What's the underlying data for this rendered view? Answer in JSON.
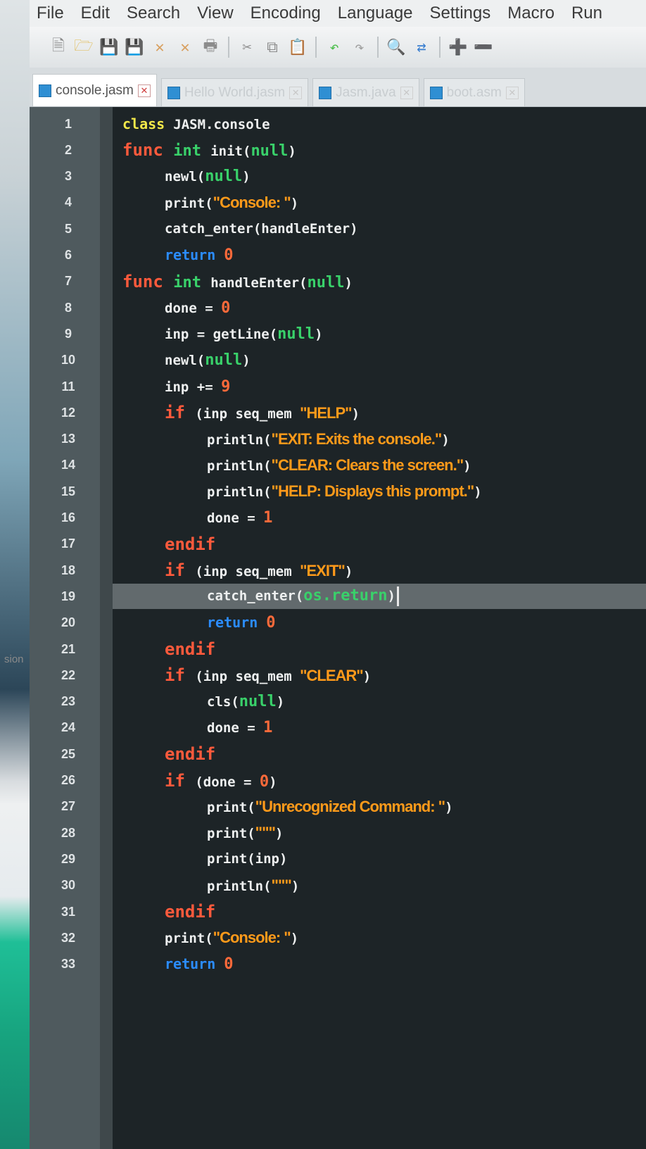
{
  "left_strip": {
    "fragment": "sion"
  },
  "menu": [
    "File",
    "Edit",
    "Search",
    "View",
    "Encoding",
    "Language",
    "Settings",
    "Macro",
    "Run"
  ],
  "toolbar": [
    "new-file-icon",
    "open-file-icon",
    "save-icon",
    "save-all-icon",
    "close-icon",
    "close-all-icon",
    "print-icon",
    "cut-icon",
    "copy-icon",
    "paste-icon",
    "undo-icon",
    "redo-icon",
    "find-icon",
    "replace-icon",
    "zoom-in-icon",
    "zoom-out-icon"
  ],
  "tabs": [
    {
      "label": "console.jasm",
      "active": true
    },
    {
      "label": "Hello World.jasm",
      "active": false
    },
    {
      "label": "Jasm.java",
      "active": false
    },
    {
      "label": "boot.asm",
      "active": false
    }
  ],
  "editor": {
    "current_line": 19,
    "lines": [
      {
        "n": "1",
        "indent": 0,
        "tokens": [
          [
            "cls",
            "class "
          ],
          [
            "t",
            "JASM.console"
          ]
        ]
      },
      {
        "n": "2",
        "indent": 0,
        "tokens": [
          [
            "red",
            "func "
          ],
          [
            "grn",
            "int "
          ],
          [
            "t",
            "init("
          ],
          [
            "grn",
            "null"
          ],
          [
            "t",
            ")"
          ]
        ]
      },
      {
        "n": "3",
        "indent": 2,
        "tokens": [
          [
            "t",
            "newl("
          ],
          [
            "grn",
            "null"
          ],
          [
            "t",
            ")"
          ]
        ]
      },
      {
        "n": "4",
        "indent": 2,
        "tokens": [
          [
            "t",
            "print("
          ],
          [
            "str",
            "\"Console: \""
          ],
          [
            "t",
            ")"
          ]
        ]
      },
      {
        "n": "5",
        "indent": 2,
        "tokens": [
          [
            "t",
            "catch_enter(handleEnter)"
          ]
        ]
      },
      {
        "n": "6",
        "indent": 2,
        "tokens": [
          [
            "blu",
            "return "
          ],
          [
            "num",
            "0"
          ]
        ]
      },
      {
        "n": "7",
        "indent": 0,
        "tokens": [
          [
            "red",
            "func "
          ],
          [
            "grn",
            "int "
          ],
          [
            "t",
            "handleEnter("
          ],
          [
            "grn",
            "null"
          ],
          [
            "t",
            ")"
          ]
        ]
      },
      {
        "n": "8",
        "indent": 2,
        "tokens": [
          [
            "t",
            "done = "
          ],
          [
            "num",
            "0"
          ]
        ]
      },
      {
        "n": "9",
        "indent": 2,
        "tokens": [
          [
            "t",
            "inp = getLine("
          ],
          [
            "grn",
            "null"
          ],
          [
            "t",
            ")"
          ]
        ]
      },
      {
        "n": "10",
        "indent": 2,
        "tokens": [
          [
            "t",
            "newl("
          ],
          [
            "grn",
            "null"
          ],
          [
            "t",
            ")"
          ]
        ]
      },
      {
        "n": "11",
        "indent": 2,
        "tokens": [
          [
            "t",
            "inp += "
          ],
          [
            "num",
            "9"
          ]
        ]
      },
      {
        "n": "12",
        "indent": 2,
        "tokens": [
          [
            "red",
            "if "
          ],
          [
            "t",
            "(inp seq_mem "
          ],
          [
            "str",
            "\"HELP\""
          ],
          [
            "t",
            ")"
          ]
        ]
      },
      {
        "n": "13",
        "indent": 4,
        "tokens": [
          [
            "t",
            "println("
          ],
          [
            "str",
            "\"EXIT: Exits the console.\""
          ],
          [
            "t",
            ")"
          ]
        ]
      },
      {
        "n": "14",
        "indent": 4,
        "tokens": [
          [
            "t",
            "println("
          ],
          [
            "str",
            "\"CLEAR: Clears the screen.\""
          ],
          [
            "t",
            ")"
          ]
        ]
      },
      {
        "n": "15",
        "indent": 4,
        "tokens": [
          [
            "t",
            "println("
          ],
          [
            "str",
            "\"HELP: Displays this prompt.\""
          ],
          [
            "t",
            ")"
          ]
        ]
      },
      {
        "n": "16",
        "indent": 4,
        "tokens": [
          [
            "t",
            "done = "
          ],
          [
            "num",
            "1"
          ]
        ]
      },
      {
        "n": "17",
        "indent": 2,
        "tokens": [
          [
            "red",
            "endif"
          ]
        ]
      },
      {
        "n": "18",
        "indent": 2,
        "tokens": [
          [
            "red",
            "if "
          ],
          [
            "t",
            "(inp seq_mem "
          ],
          [
            "str",
            "\"EXIT\""
          ],
          [
            "t",
            ")"
          ]
        ]
      },
      {
        "n": "19",
        "indent": 4,
        "tokens": [
          [
            "t",
            "catch_enter("
          ],
          [
            "grn",
            "os.return"
          ],
          [
            "t",
            ")"
          ]
        ]
      },
      {
        "n": "20",
        "indent": 4,
        "tokens": [
          [
            "blu",
            "return "
          ],
          [
            "num",
            "0"
          ]
        ]
      },
      {
        "n": "21",
        "indent": 2,
        "tokens": [
          [
            "red",
            "endif"
          ]
        ]
      },
      {
        "n": "22",
        "indent": 2,
        "tokens": [
          [
            "red",
            "if "
          ],
          [
            "t",
            "(inp seq_mem "
          ],
          [
            "str",
            "\"CLEAR\""
          ],
          [
            "t",
            ")"
          ]
        ]
      },
      {
        "n": "23",
        "indent": 4,
        "tokens": [
          [
            "t",
            "cls("
          ],
          [
            "grn",
            "null"
          ],
          [
            "t",
            ")"
          ]
        ]
      },
      {
        "n": "24",
        "indent": 4,
        "tokens": [
          [
            "t",
            "done = "
          ],
          [
            "num",
            "1"
          ]
        ]
      },
      {
        "n": "25",
        "indent": 2,
        "tokens": [
          [
            "red",
            "endif"
          ]
        ]
      },
      {
        "n": "26",
        "indent": 2,
        "tokens": [
          [
            "red",
            "if "
          ],
          [
            "t",
            "(done = "
          ],
          [
            "num",
            "0"
          ],
          [
            "t",
            ")"
          ]
        ]
      },
      {
        "n": "27",
        "indent": 4,
        "tokens": [
          [
            "t",
            "print("
          ],
          [
            "str",
            "\"Unrecognized Command: \""
          ],
          [
            "t",
            ")"
          ]
        ]
      },
      {
        "n": "28",
        "indent": 4,
        "tokens": [
          [
            "t",
            "print("
          ],
          [
            "str",
            "\"\"\""
          ],
          [
            "t",
            ")"
          ]
        ]
      },
      {
        "n": "29",
        "indent": 4,
        "tokens": [
          [
            "t",
            "print(inp)"
          ]
        ]
      },
      {
        "n": "30",
        "indent": 4,
        "tokens": [
          [
            "t",
            "println("
          ],
          [
            "str",
            "\"\"\""
          ],
          [
            "t",
            ")"
          ]
        ]
      },
      {
        "n": "31",
        "indent": 2,
        "tokens": [
          [
            "red",
            "endif"
          ]
        ]
      },
      {
        "n": "32",
        "indent": 2,
        "tokens": [
          [
            "t",
            "print("
          ],
          [
            "str",
            "\"Console: \""
          ],
          [
            "t",
            ")"
          ]
        ]
      },
      {
        "n": "33",
        "indent": 2,
        "tokens": [
          [
            "blu",
            "return "
          ],
          [
            "num",
            "0"
          ]
        ]
      }
    ]
  }
}
